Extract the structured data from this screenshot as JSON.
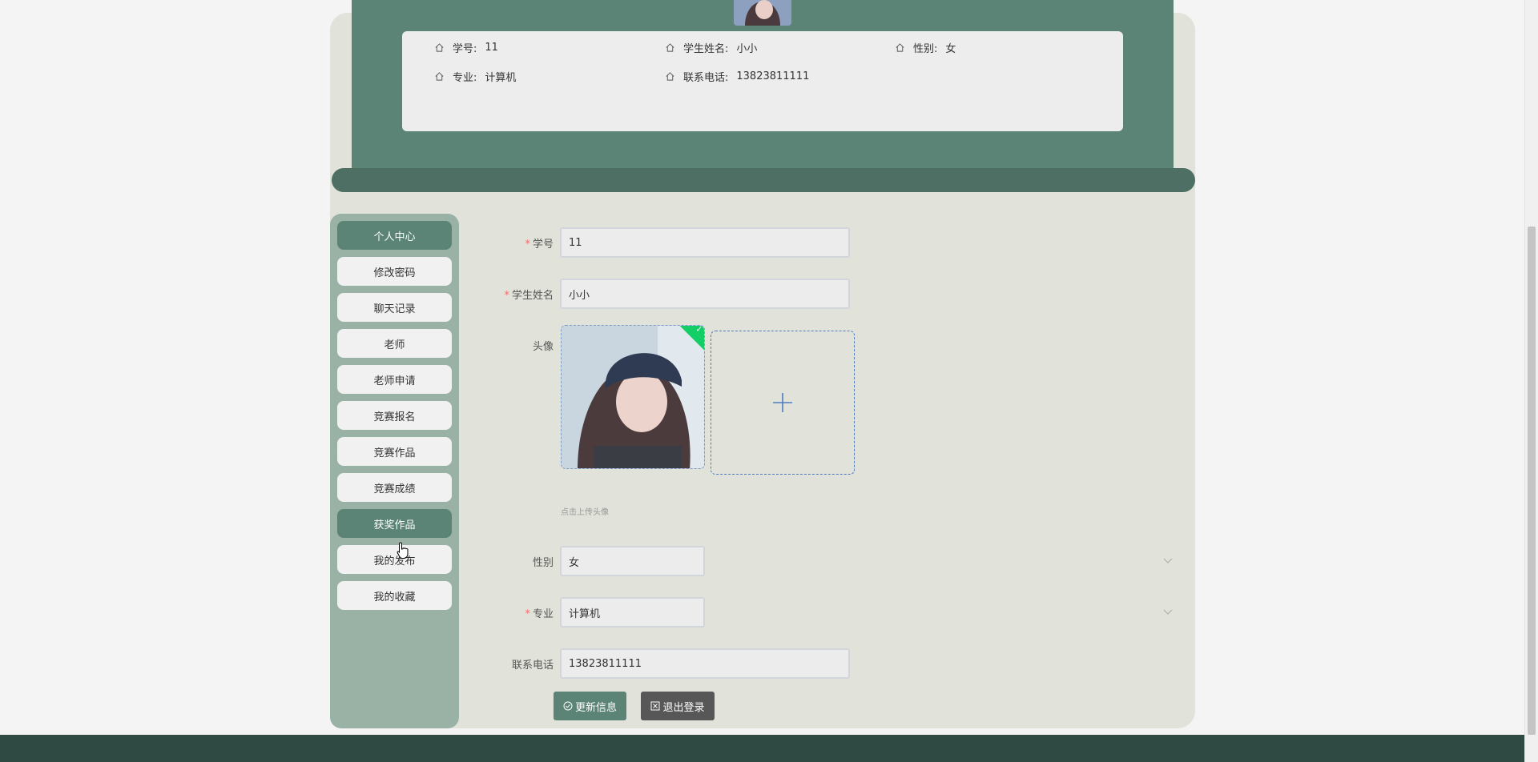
{
  "info_card": {
    "student_no_label": "学号:",
    "student_no": "11",
    "student_name_label": "学生姓名:",
    "student_name": "小小",
    "gender_label": "性别:",
    "gender": "女",
    "major_label": "专业:",
    "major": "计算机",
    "phone_label": "联系电话:",
    "phone": "13823811111"
  },
  "sidebar": {
    "items": [
      {
        "label": "个人中心",
        "active": true
      },
      {
        "label": "修改密码",
        "active": false
      },
      {
        "label": "聊天记录",
        "active": false
      },
      {
        "label": "老师",
        "active": false
      },
      {
        "label": "老师申请",
        "active": false
      },
      {
        "label": "竞赛报名",
        "active": false
      },
      {
        "label": "竞赛作品",
        "active": false
      },
      {
        "label": "竞赛成绩",
        "active": false
      },
      {
        "label": "获奖作品",
        "active": true
      },
      {
        "label": "我的发布",
        "active": false
      },
      {
        "label": "我的收藏",
        "active": false
      }
    ]
  },
  "form": {
    "student_no_label": "学号",
    "student_no_value": "11",
    "student_name_label": "学生姓名",
    "student_name_value": "小小",
    "avatar_label": "头像",
    "upload_tip": "点击上传头像",
    "gender_label": "性别",
    "gender_value": "女",
    "major_label": "专业",
    "major_value": "计算机",
    "phone_label": "联系电话",
    "phone_value": "13823811111",
    "update_button": "更新信息",
    "logout_button": "退出登录"
  },
  "colors": {
    "primary": "#5b8477",
    "sidebar_bg": "#9ab2a6",
    "panel_bg": "#e1e2da",
    "footer": "#2e4a42",
    "logout": "#575757",
    "required": "#f56c6c"
  }
}
